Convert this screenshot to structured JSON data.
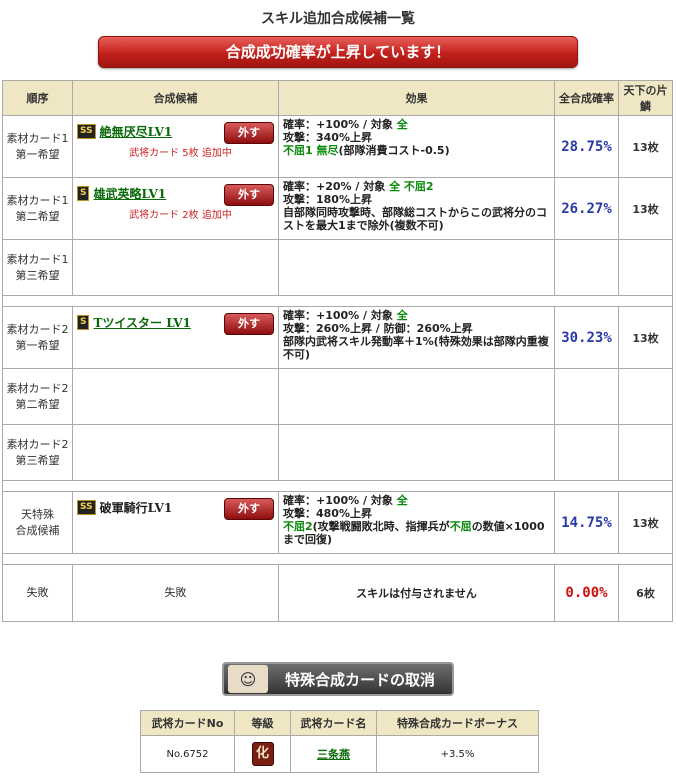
{
  "page_title": "スキル追加合成候補一覧",
  "banner": "合成成功確率が上昇しています！",
  "headers": {
    "order": "順序",
    "candidate": "合成候補",
    "effect": "効果",
    "rate": "全合成確率",
    "count": "天下の片鱗"
  },
  "rows": [
    {
      "order1": "素材カード1",
      "order2": "第一希望",
      "badge": "SS",
      "skill": "絶無厌尽LV1",
      "remove": "外す",
      "added": "武将カード 5枚 追加中",
      "effect": [
        {
          "t": "確率：+100% / 対象 "
        },
        {
          "g": "全"
        },
        {
          "br": true
        },
        {
          "t": "攻撃：340%上昇"
        },
        {
          "br": true
        },
        {
          "g": "不屈1 無尽"
        },
        {
          "t": "(部隊消費コスト-0.5)"
        }
      ],
      "rate": "28.75%",
      "count": "13枚"
    },
    {
      "order1": "素材カード1",
      "order2": "第二希望",
      "badge": "S",
      "skill": "雄武英略LV1",
      "remove": "外す",
      "added": "武将カード 2枚 追加中",
      "effect": [
        {
          "t": "確率：+20% / 対象 "
        },
        {
          "g": "全 不屈2"
        },
        {
          "br": true
        },
        {
          "t": "攻撃：180%上昇"
        },
        {
          "br": true
        },
        {
          "t": "自部隊同時攻撃時、部隊総コストからこの武将分のコストを最大1まで除外(複数不可)"
        }
      ],
      "rate": "26.27%",
      "count": "13枚"
    },
    {
      "order1": "素材カード1",
      "order2": "第三希望",
      "empty": true
    },
    {
      "sep": true
    },
    {
      "order1": "素材カード2",
      "order2": "第一希望",
      "badge": "S",
      "skill": "Tツイスター LV1",
      "remove": "外す",
      "effect": [
        {
          "t": "確率：+100% / 対象 "
        },
        {
          "g": "全"
        },
        {
          "br": true
        },
        {
          "t": "攻撃：260%上昇 / 防御：260%上昇"
        },
        {
          "br": true
        },
        {
          "t": "部隊内武将スキル発動率＋1%(特殊効果は部隊内重複不可)"
        }
      ],
      "rate": "30.23%",
      "count": "13枚"
    },
    {
      "order1": "素材カード2",
      "order2": "第二希望",
      "empty": true
    },
    {
      "order1": "素材カード2",
      "order2": "第三希望",
      "empty": true
    },
    {
      "sep": true
    },
    {
      "order1": "天特殊",
      "order2": "合成候補",
      "badge": "SS",
      "skill": "破軍騎行LV1",
      "plain": true,
      "remove": "外す",
      "effect": [
        {
          "t": "確率：+100% / 対象 "
        },
        {
          "g": "全"
        },
        {
          "br": true
        },
        {
          "t": "攻撃：480%上昇"
        },
        {
          "br": true
        },
        {
          "g": "不屈2"
        },
        {
          "t": "(攻撃戦闘敗北時、指揮兵が"
        },
        {
          "g": "不屈"
        },
        {
          "t": "の数値×1000まで回復)"
        }
      ],
      "rate": "14.75%",
      "count": "13枚"
    },
    {
      "sep": true
    },
    {
      "fail": true,
      "order1": "失敗",
      "candidate": "失敗",
      "effect_text": "スキルは付与されません",
      "rate": "0.00%",
      "count": "6枚"
    }
  ],
  "cancel_button": "特殊合成カードの取消",
  "bonus_table": {
    "headers": [
      "武将カードNo",
      "等級",
      "武将カード名",
      "特殊合成カードボーナス"
    ],
    "row": {
      "no": "No.6752",
      "grade": "化",
      "name": "三条燕",
      "bonus": "+3.5%"
    }
  },
  "icons": {
    "remove": "remove-button",
    "face": "character-portrait-icon"
  }
}
